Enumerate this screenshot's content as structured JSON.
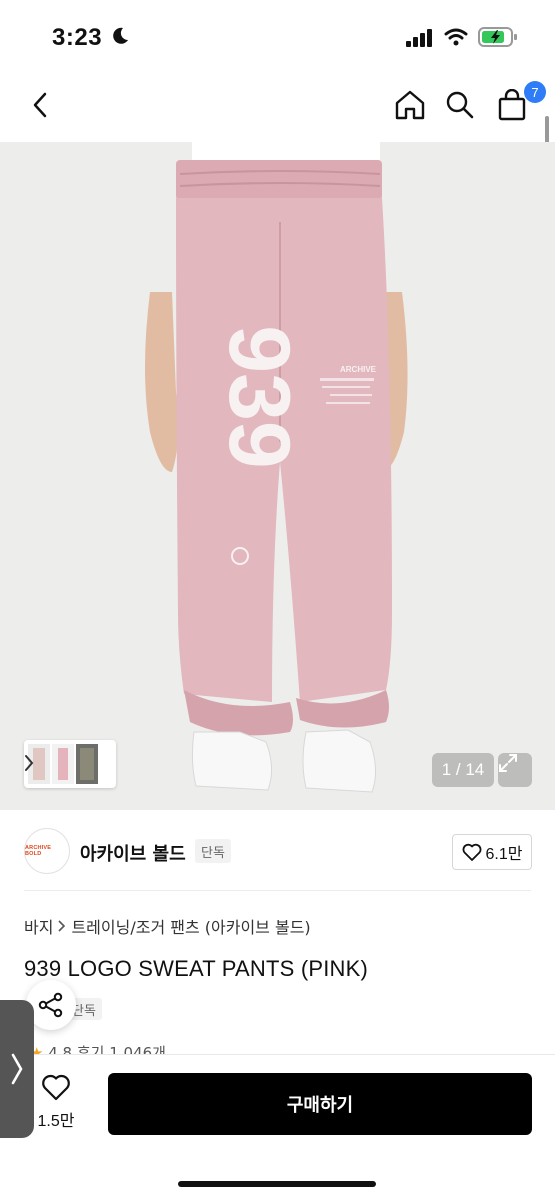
{
  "status_bar": {
    "time": "3:23"
  },
  "nav": {
    "cart_count": "7"
  },
  "gallery": {
    "counter": "1 / 14",
    "print_number": "939",
    "print_text": "ARCHIVE"
  },
  "brand": {
    "logo_text": "ARCHIVE BOLD",
    "name": "아카이브 볼드",
    "badge": "단독",
    "likes": "6.1만"
  },
  "breadcrumb": {
    "category": "바지",
    "subcategory": "트레이닝/조거 팬츠 (아카이브 볼드)"
  },
  "product": {
    "title": "939 LOGO SWEAT PANTS (PINK)",
    "exclusive_badge": "단독",
    "rating": "4.8",
    "reviews": "후기 1,046개"
  },
  "bottom_bar": {
    "wish_count": "1.5만",
    "buy_label": "구매하기"
  },
  "colors": {
    "accent_badge": "#2e7cf6",
    "pants": "#e2b7be",
    "buy_button": "#000000"
  }
}
